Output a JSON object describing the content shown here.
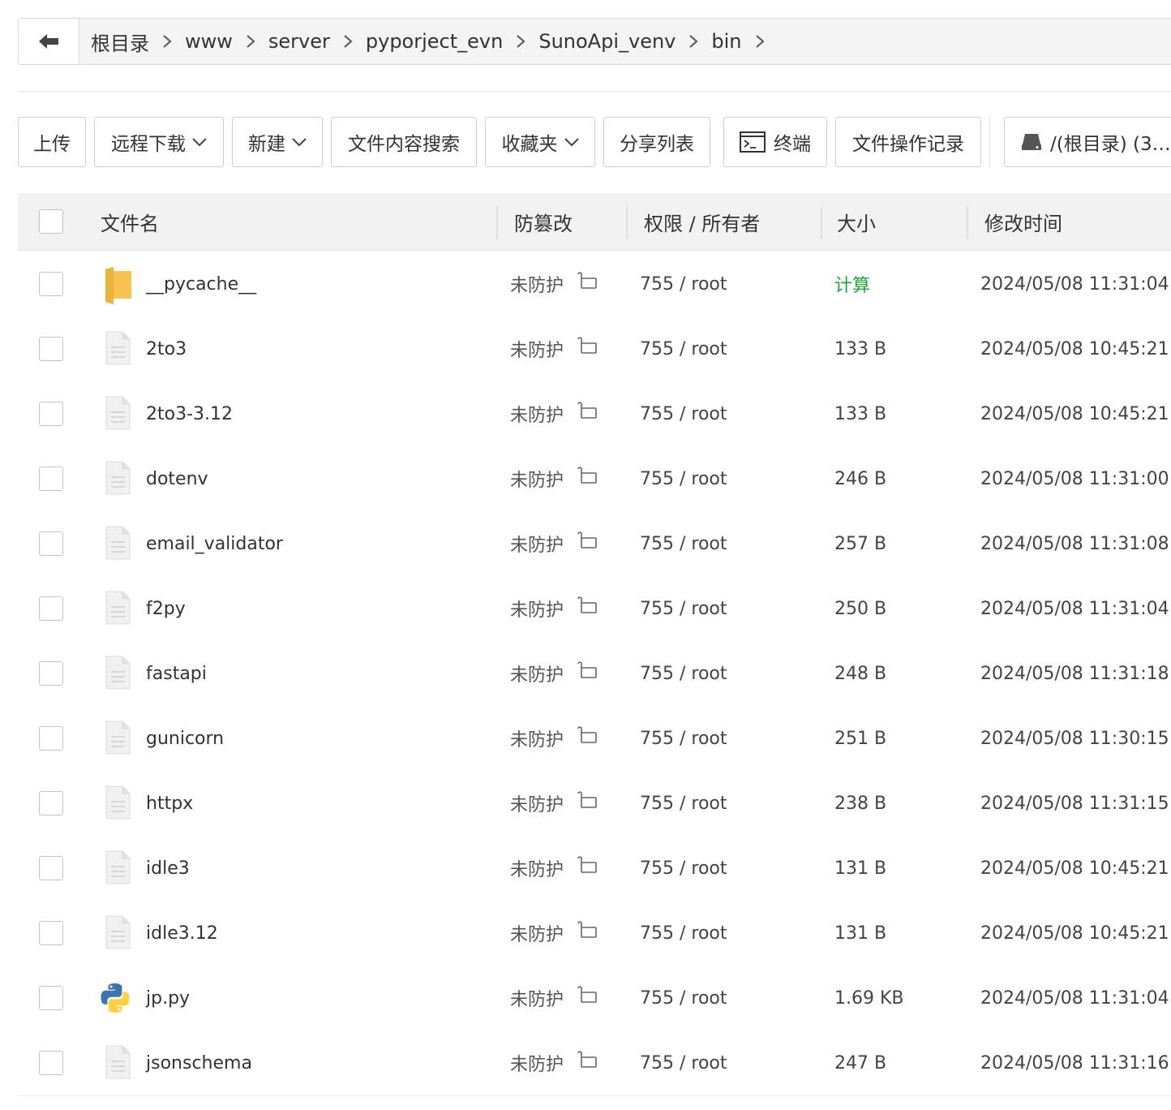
{
  "breadcrumb": {
    "items": [
      "根目录",
      "www",
      "server",
      "pyporject_evn",
      "SunoApi_venv",
      "bin"
    ]
  },
  "toolbar": {
    "upload": "上传",
    "remote_download": "远程下载",
    "new": "新建",
    "content_search": "文件内容搜索",
    "favorites": "收藏夹",
    "share_list": "分享列表",
    "terminal": "终端",
    "op_log": "文件操作记录",
    "disk": "/(根目录) (3…"
  },
  "table": {
    "headers": {
      "name": "文件名",
      "tamper": "防篡改",
      "perm_owner": "权限 / 所有者",
      "size": "大小",
      "mtime": "修改时间"
    },
    "rows": [
      {
        "type": "folder",
        "name": "__pycache__",
        "tamper": "未防护",
        "perm": "755 / root",
        "size": "计算",
        "mtime": "2024/05/08 11:31:04"
      },
      {
        "type": "file",
        "name": "2to3",
        "tamper": "未防护",
        "perm": "755 / root",
        "size": "133 B",
        "mtime": "2024/05/08 10:45:21"
      },
      {
        "type": "file",
        "name": "2to3-3.12",
        "tamper": "未防护",
        "perm": "755 / root",
        "size": "133 B",
        "mtime": "2024/05/08 10:45:21"
      },
      {
        "type": "file",
        "name": "dotenv",
        "tamper": "未防护",
        "perm": "755 / root",
        "size": "246 B",
        "mtime": "2024/05/08 11:31:00"
      },
      {
        "type": "file",
        "name": "email_validator",
        "tamper": "未防护",
        "perm": "755 / root",
        "size": "257 B",
        "mtime": "2024/05/08 11:31:08"
      },
      {
        "type": "file",
        "name": "f2py",
        "tamper": "未防护",
        "perm": "755 / root",
        "size": "250 B",
        "mtime": "2024/05/08 11:31:04"
      },
      {
        "type": "file",
        "name": "fastapi",
        "tamper": "未防护",
        "perm": "755 / root",
        "size": "248 B",
        "mtime": "2024/05/08 11:31:18"
      },
      {
        "type": "file",
        "name": "gunicorn",
        "tamper": "未防护",
        "perm": "755 / root",
        "size": "251 B",
        "mtime": "2024/05/08 11:30:15"
      },
      {
        "type": "file",
        "name": "httpx",
        "tamper": "未防护",
        "perm": "755 / root",
        "size": "238 B",
        "mtime": "2024/05/08 11:31:15"
      },
      {
        "type": "file",
        "name": "idle3",
        "tamper": "未防护",
        "perm": "755 / root",
        "size": "131 B",
        "mtime": "2024/05/08 10:45:21"
      },
      {
        "type": "file",
        "name": "idle3.12",
        "tamper": "未防护",
        "perm": "755 / root",
        "size": "131 B",
        "mtime": "2024/05/08 10:45:21"
      },
      {
        "type": "python",
        "name": "jp.py",
        "tamper": "未防护",
        "perm": "755 / root",
        "size": "1.69 KB",
        "mtime": "2024/05/08 11:31:04"
      },
      {
        "type": "file",
        "name": "jsonschema",
        "tamper": "未防护",
        "perm": "755 / root",
        "size": "247 B",
        "mtime": "2024/05/08 11:31:16"
      }
    ]
  },
  "colors": {
    "accent_green": "#20a53a",
    "folder_yellow": "#f5c451",
    "border": "#d9d9d9"
  }
}
